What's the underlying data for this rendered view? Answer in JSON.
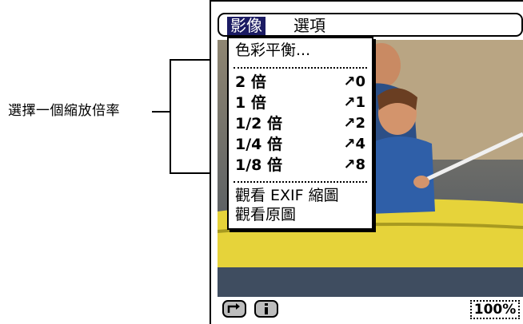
{
  "callout": {
    "label": "選擇一個縮放倍率"
  },
  "menubar": {
    "active_menu": "影像",
    "other_menu": "選項"
  },
  "dropdown": {
    "color_balance": "色彩平衡...",
    "zoom_items": [
      {
        "label": "2 倍",
        "shortcut": "↗0"
      },
      {
        "label": "1 倍",
        "shortcut": "↗1"
      },
      {
        "label": "1/2 倍",
        "shortcut": "↗2"
      },
      {
        "label": "1/4 倍",
        "shortcut": "↗4"
      },
      {
        "label": "1/8 倍",
        "shortcut": "↗8"
      }
    ],
    "view_exif": "觀看 EXIF 縮圖",
    "view_original": "觀看原圖"
  },
  "toolbar": {
    "zoom_level": "100%"
  },
  "icons": {
    "rotate": "rotate-icon",
    "info": "info-icon"
  }
}
